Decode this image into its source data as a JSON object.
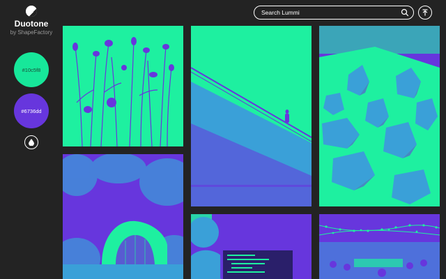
{
  "app": {
    "name": "Duotone",
    "byline": "by ShapeFactory"
  },
  "colors": {
    "light": "#10c5f8",
    "dark": "#6736dd"
  },
  "search": {
    "placeholder": "Search Lummi"
  },
  "icons": {
    "logo": "half-circle-logo-icon",
    "drop": "water-drop-icon",
    "search": "search-icon",
    "upload": "upload-arrow-icon"
  },
  "gallery": [
    {
      "subject": "dried wildflowers"
    },
    {
      "subject": "escalator with person"
    },
    {
      "subject": "quartz crystals"
    },
    {
      "subject": "concrete arch house in forest"
    },
    {
      "subject": "person at laptop with code"
    },
    {
      "subject": "night market with string lights"
    }
  ]
}
